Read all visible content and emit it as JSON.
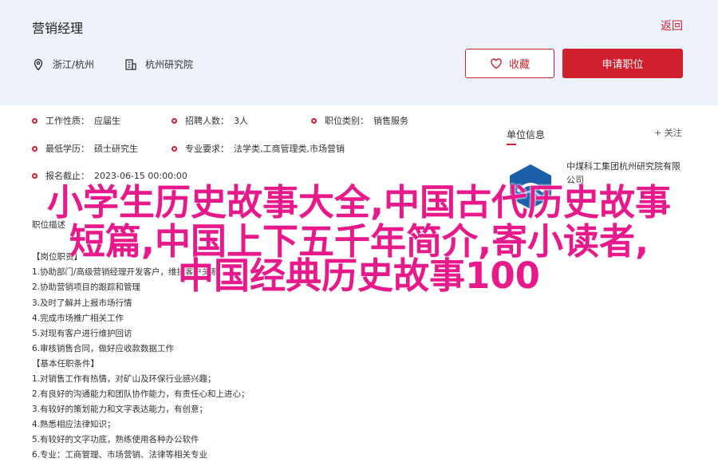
{
  "header": {
    "job_title": "营销经理",
    "back_label": "返回",
    "location": "浙江/杭州",
    "org": "杭州研究院",
    "fav_label": "收藏",
    "apply_label": "申请职位"
  },
  "info": [
    {
      "label": "工作性质：",
      "value": "应届生"
    },
    {
      "label": "招聘人数：",
      "value": "3人"
    },
    {
      "label": "职位类别：",
      "value": "销售服务"
    },
    {
      "label": "最低学历：",
      "value": "硕士研究生"
    },
    {
      "label": "专业要求：",
      "value": "法学类,工商管理类,市场营销"
    },
    {
      "label": "报名截止：",
      "value": "2023-06-15 00:00:00"
    }
  ],
  "side": {
    "title": "单位信息",
    "follow": "+ 关注",
    "company": "中煤科工集团杭州研究院有限公司"
  },
  "description": {
    "lines": [
      "职位描述",
      "【岗位职责】",
      "1.协助部门/高级营销经理开发客户，维护客户关系",
      "2.协助营销项目的跟踪和管理",
      "3.及时了解并上报市场行情",
      "4.完成市场推广相关工作",
      "5.对现有客户进行维护回访",
      "6.审核销售合同，做好应收款数据工作",
      "【基本任职条件】",
      "1.对销售工作有热情，对矿山及环保行业感兴趣；",
      "2.有良好的沟通能力和团队协作能力，有责任心和上进心；",
      "3.有较好的策划能力和文字表达能力，有创意；",
      "4.熟悉相应法律知识；",
      "5.有较好的文字功底，熟练使用各种办公软件",
      "6.专业：工商管理、市场营销、法律等相关专业"
    ]
  },
  "overlay": {
    "line1": "小学生历史故事大全,中国古代历史故事",
    "line2": "短篇,中国上下五千年简介,寄小读者,",
    "line3": "中国经典历史故事100"
  },
  "colors": {
    "brand_red": "#d0202e",
    "header_bg": "#eef3fb",
    "overlay_magenta": "#e8198b"
  },
  "icons": {
    "location": "location-pin-icon",
    "org": "building-icon",
    "fav": "heart-icon",
    "info_bullet": "circle-dot-icon",
    "company_logo": "hexagon-logo"
  }
}
